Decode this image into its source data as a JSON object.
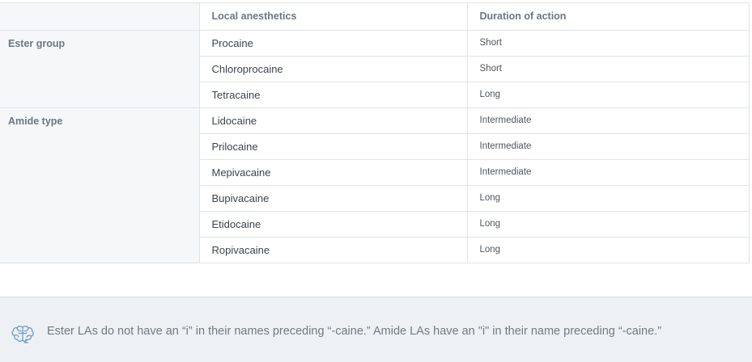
{
  "table": {
    "headers": [
      "",
      "Local anesthetics",
      "Duration of action"
    ],
    "groups": [
      {
        "label": "Ester group",
        "rows": [
          {
            "name": "Procaine",
            "duration": "Short"
          },
          {
            "name": "Chloroprocaine",
            "duration": "Short"
          },
          {
            "name": "Tetracaine",
            "duration": "Long"
          }
        ]
      },
      {
        "label": "Amide type",
        "rows": [
          {
            "name": "Lidocaine",
            "duration": "Intermediate"
          },
          {
            "name": "Prilocaine",
            "duration": "Intermediate"
          },
          {
            "name": "Mepivacaine",
            "duration": "Intermediate"
          },
          {
            "name": "Bupivacaine",
            "duration": "Long"
          },
          {
            "name": "Etidocaine",
            "duration": "Long"
          },
          {
            "name": "Ropivacaine",
            "duration": "Long"
          }
        ]
      }
    ]
  },
  "note": {
    "icon": "brain-icon",
    "text": "Ester LAs do not have an “i” in their names preceding “-caine.” Amide LAs have an \"i\" in their name preceding “-caine.”"
  }
}
